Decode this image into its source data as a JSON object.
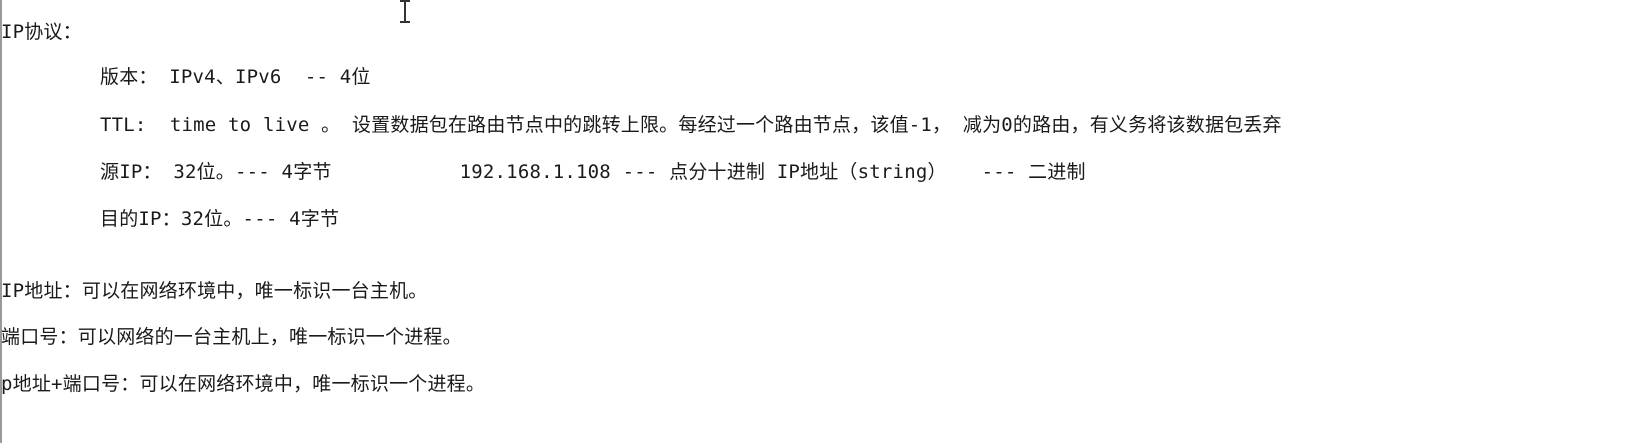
{
  "document": {
    "heading": "IP协议：",
    "fields": [
      {
        "text": "版本： IPv4、IPv6  -- 4位"
      },
      {
        "text": "TTL:  time to live 。 设置数据包在路由节点中的跳转上限。每经过一个路由节点，该值-1， 减为0的路由，有义务将该数据包丢弃"
      },
      {
        "text": "源IP： 32位。--- 4字节           192.168.1.108 --- 点分十进制 IP地址（string）   --- 二进制"
      },
      {
        "text": "目的IP：32位。--- 4字节"
      }
    ],
    "notes": [
      {
        "text": "IP地址：可以在网络环境中，唯一标识一台主机。"
      },
      {
        "text": "端口号：可以网络的一台主机上，唯一标识一个进程。"
      },
      {
        "text": "p地址+端口号：可以在网络环境中，唯一标识一个进程。"
      }
    ]
  },
  "cursor_icon": "text-cursor-icon"
}
